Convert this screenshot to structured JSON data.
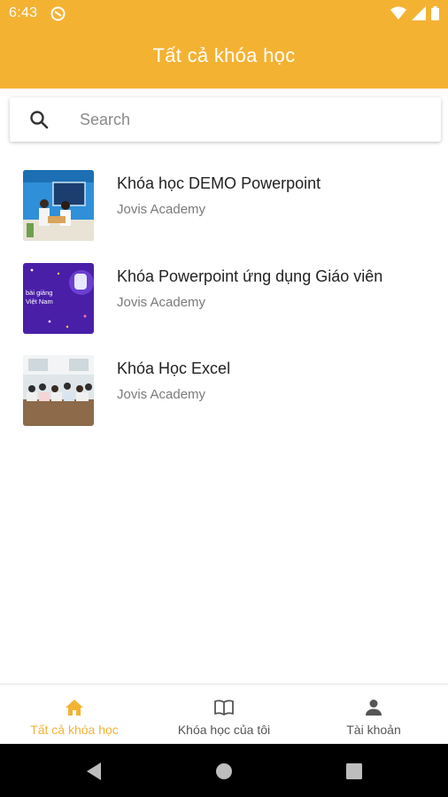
{
  "status_bar": {
    "time": "6:43"
  },
  "header": {
    "title": "Tất cả khóa học"
  },
  "search": {
    "placeholder": "Search"
  },
  "courses": [
    {
      "title": "Khóa học DEMO Powerpoint",
      "author": "Jovis Academy"
    },
    {
      "title": "Khóa Powerpoint ứng dụng Giáo viên",
      "author": "Jovis Academy",
      "thumb_text_1": "bài giảng",
      "thumb_text_2": "Việt Nam"
    },
    {
      "title": "Khóa Học Excel",
      "author": "Jovis Academy"
    }
  ],
  "bottom_nav": {
    "items": [
      {
        "label": "Tất cả khóa học",
        "icon": "home-icon",
        "active": true
      },
      {
        "label": "Khóa học của tôi",
        "icon": "book-icon",
        "active": false
      },
      {
        "label": "Tài khoản",
        "icon": "person-icon",
        "active": false
      }
    ]
  },
  "colors": {
    "accent": "#F4B233",
    "system_nav": "#000000"
  }
}
